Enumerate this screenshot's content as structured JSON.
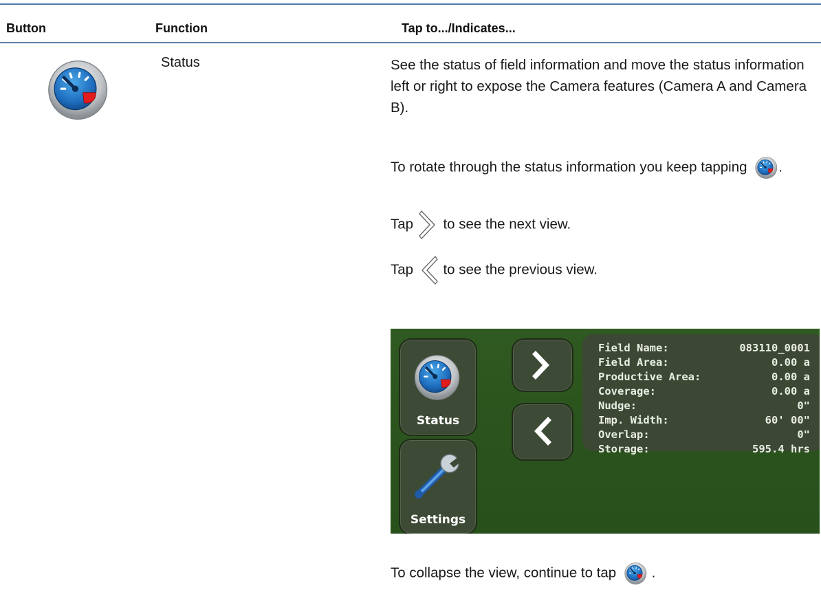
{
  "header": {
    "col_button": "Button",
    "col_function": "Function",
    "col_tap": "Tap to.../Indicates..."
  },
  "row": {
    "function": "Status",
    "p1": "See the status of field information and move the status information left or right to expose the Camera features (Camera A and Camera B).",
    "p2_text": "To rotate through the status information you keep tapping",
    "p2_end": ".",
    "p3_start": "Tap",
    "p3_end": "to see the next view.",
    "p4_start": "Tap",
    "p4_end": "to see the previous view.",
    "p5_text": "To collapse the view, continue to tap",
    "p5_end": "."
  },
  "screen": {
    "status_label": "Status",
    "settings_label": "Settings",
    "status_rows": [
      {
        "key": "Field Name:",
        "value": "083110_0001"
      },
      {
        "key": "Field Area:",
        "value": "0.00 a"
      },
      {
        "key": "Productive Area:",
        "value": "0.00 a"
      },
      {
        "key": "Coverage:",
        "value": "0.00 a"
      },
      {
        "key": "Nudge:",
        "value": "0\""
      },
      {
        "key": "Imp. Width:",
        "value": "60' 00\""
      },
      {
        "key": "Overlap:",
        "value": "0\""
      },
      {
        "key": "Storage:",
        "value": "595.4 hrs"
      }
    ]
  },
  "icons": {
    "status": "status-gauge-icon",
    "next": "chevron-right-icon",
    "previous": "chevron-left-icon",
    "settings": "wrench-icon"
  },
  "colors": {
    "header_rule": "#4f79a8",
    "screen_bg": "#2f5a21",
    "tile_bg": "#3d4a35"
  }
}
